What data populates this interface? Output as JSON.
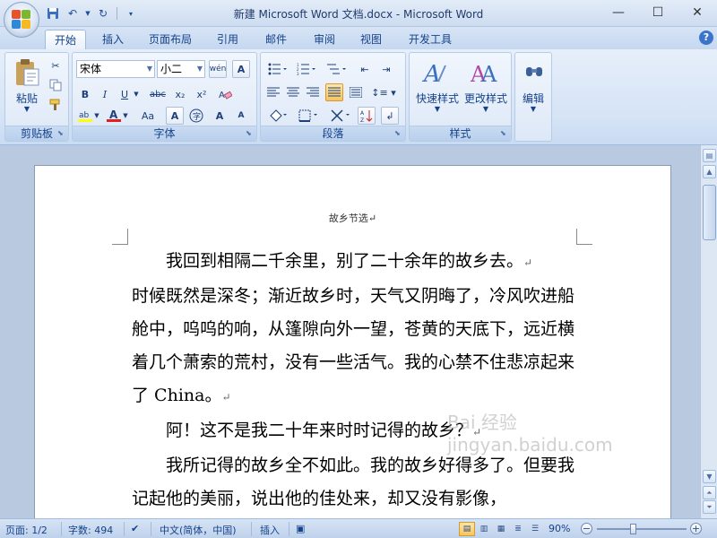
{
  "window": {
    "title": "新建 Microsoft Word 文档.docx - Microsoft Word",
    "minimize": "—",
    "maximize": "☐",
    "close": "✕"
  },
  "qat": {
    "save_icon": "save-icon",
    "undo_icon": "undo-icon",
    "redo_icon": "redo-icon"
  },
  "tabs": [
    "开始",
    "插入",
    "页面布局",
    "引用",
    "邮件",
    "审阅",
    "视图",
    "开发工具"
  ],
  "ribbon": {
    "clipboard": {
      "label": "剪贴板",
      "paste": "粘贴"
    },
    "font": {
      "label": "字体",
      "font_name": "宋体",
      "font_size": "小二",
      "bold": "B",
      "italic": "I",
      "underline": "U",
      "strike": "abc",
      "subscript": "x₂",
      "superscript": "x²",
      "grow": "A",
      "shrink": "A",
      "case": "Aa",
      "clear": "A"
    },
    "paragraph": {
      "label": "段落"
    },
    "styles": {
      "label": "样式",
      "quick": "快速样式",
      "change": "更改样式"
    },
    "editing": {
      "label": "编辑"
    }
  },
  "document": {
    "header": "故乡节选↵",
    "paragraphs": [
      "我回到相隔二千余里，别了二十余年的故乡去。",
      "时候既然是深冬；渐近故乡时，天气又阴晦了，冷风吹进船舱中，呜呜的响，从篷隙向外一望，苍黄的天底下，远近横着几个萧索的荒村，没有一些活气。我的心禁不住悲凉起来了 China。",
      "阿！这不是我二十年来时时记得的故乡？",
      "我所记得的故乡全不如此。我的故乡好得多了。但要我记起他的美丽，说出他的佳处来，却又没有影像，"
    ],
    "paragraph_mark": "↵",
    "watermark": "Bai 经验 jingyan.baidu.com"
  },
  "statusbar": {
    "page": "页面: 1/2",
    "words": "字数: 494",
    "language": "中文(简体，中国)",
    "mode": "插入",
    "zoom": "90%"
  }
}
